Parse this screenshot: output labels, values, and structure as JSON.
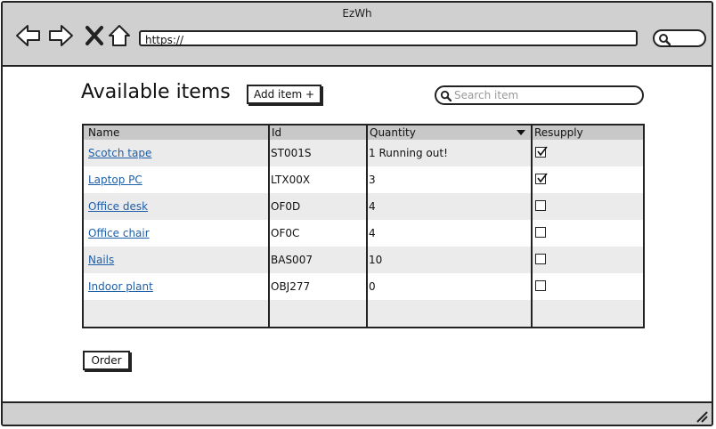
{
  "window": {
    "title": "EzWh"
  },
  "browser": {
    "url": "https://"
  },
  "page": {
    "title": "Available items",
    "add_button": "Add item +",
    "search_placeholder": "Search item",
    "order_button": "Order"
  },
  "table": {
    "headers": [
      "Name",
      "Id",
      "Quantity",
      "Resupply"
    ],
    "sort_column": "Quantity",
    "rows": [
      {
        "name": "Scotch tape",
        "id": "ST001S",
        "quantity": "1 Running out!",
        "resupply": true
      },
      {
        "name": "Laptop PC",
        "id": "LTX00X",
        "quantity": "3",
        "resupply": true
      },
      {
        "name": "Office desk",
        "id": "OF0D",
        "quantity": "4",
        "resupply": false
      },
      {
        "name": "Office chair",
        "id": "OF0C",
        "quantity": "4",
        "resupply": false
      },
      {
        "name": "Nails",
        "id": "BAS007",
        "quantity": "10",
        "resupply": false
      },
      {
        "name": "Indoor plant",
        "id": "OBJ277",
        "quantity": "0",
        "resupply": false
      }
    ]
  },
  "icons": [
    "back-arrow-icon",
    "forward-arrow-icon",
    "close-icon",
    "home-icon",
    "search-icon",
    "checkmark-icon",
    "sort-arrow-icon",
    "resize-grip-icon"
  ]
}
